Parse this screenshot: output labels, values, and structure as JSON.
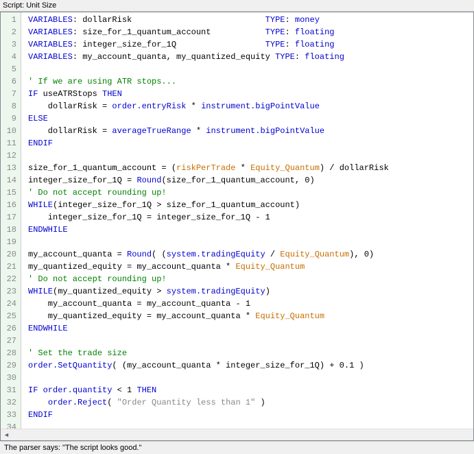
{
  "window": {
    "title": "Script: Unit Size"
  },
  "status": {
    "text": "The parser says: \"The script looks good.\""
  },
  "code": {
    "lines": [
      [
        {
          "t": "VARIABLES",
          "c": "kw"
        },
        {
          "t": ": dollarRisk                           ",
          "c": ""
        },
        {
          "t": "TYPE",
          "c": "kw"
        },
        {
          "t": ": ",
          "c": ""
        },
        {
          "t": "money",
          "c": "kw"
        }
      ],
      [
        {
          "t": "VARIABLES",
          "c": "kw"
        },
        {
          "t": ": size_for_1_quantum_account           ",
          "c": ""
        },
        {
          "t": "TYPE",
          "c": "kw"
        },
        {
          "t": ": ",
          "c": ""
        },
        {
          "t": "floating",
          "c": "kw"
        }
      ],
      [
        {
          "t": "VARIABLES",
          "c": "kw"
        },
        {
          "t": ": integer_size_for_1Q                  ",
          "c": ""
        },
        {
          "t": "TYPE",
          "c": "kw"
        },
        {
          "t": ": ",
          "c": ""
        },
        {
          "t": "floating",
          "c": "kw"
        }
      ],
      [
        {
          "t": "VARIABLES",
          "c": "kw"
        },
        {
          "t": ": my_account_quanta, my_quantized_equity ",
          "c": ""
        },
        {
          "t": "TYPE",
          "c": "kw"
        },
        {
          "t": ": ",
          "c": ""
        },
        {
          "t": "floating",
          "c": "kw"
        }
      ],
      [],
      [
        {
          "t": "' If we are using ATR stops...",
          "c": "com"
        }
      ],
      [
        {
          "t": "IF",
          "c": "kw"
        },
        {
          "t": " useATRStops ",
          "c": ""
        },
        {
          "t": "THEN",
          "c": "kw"
        }
      ],
      [
        {
          "t": "    dollarRisk = ",
          "c": ""
        },
        {
          "t": "order.entryRisk",
          "c": "kw"
        },
        {
          "t": " * ",
          "c": ""
        },
        {
          "t": "instrument.bigPointValue",
          "c": "kw"
        }
      ],
      [
        {
          "t": "ELSE",
          "c": "kw"
        }
      ],
      [
        {
          "t": "    dollarRisk = ",
          "c": ""
        },
        {
          "t": "averageTrueRange",
          "c": "kw"
        },
        {
          "t": " * ",
          "c": ""
        },
        {
          "t": "instrument.bigPointValue",
          "c": "kw"
        }
      ],
      [
        {
          "t": "ENDIF",
          "c": "kw"
        }
      ],
      [],
      [
        {
          "t": "size_for_1_quantum_account = (",
          "c": ""
        },
        {
          "t": "riskPerTrade",
          "c": "sys"
        },
        {
          "t": " * ",
          "c": ""
        },
        {
          "t": "Equity_Quantum",
          "c": "sys"
        },
        {
          "t": ") / dollarRisk",
          "c": ""
        }
      ],
      [
        {
          "t": "integer_size_for_1Q = ",
          "c": ""
        },
        {
          "t": "Round",
          "c": "kw"
        },
        {
          "t": "(size_for_1_quantum_account, 0)",
          "c": ""
        }
      ],
      [
        {
          "t": "' Do not accept rounding up!",
          "c": "com"
        }
      ],
      [
        {
          "t": "WHILE",
          "c": "kw"
        },
        {
          "t": "(integer_size_for_1Q > size_for_1_quantum_account)",
          "c": ""
        }
      ],
      [
        {
          "t": "    integer_size_for_1Q = integer_size_for_1Q - 1",
          "c": ""
        }
      ],
      [
        {
          "t": "ENDWHILE",
          "c": "kw"
        }
      ],
      [],
      [
        {
          "t": "my_account_quanta = ",
          "c": ""
        },
        {
          "t": "Round",
          "c": "kw"
        },
        {
          "t": "( (",
          "c": ""
        },
        {
          "t": "system.tradingEquity",
          "c": "kw"
        },
        {
          "t": " / ",
          "c": ""
        },
        {
          "t": "Equity_Quantum",
          "c": "sys"
        },
        {
          "t": "), 0)",
          "c": ""
        }
      ],
      [
        {
          "t": "my_quantized_equity = my_account_quanta * ",
          "c": ""
        },
        {
          "t": "Equity_Quantum",
          "c": "sys"
        }
      ],
      [
        {
          "t": "' Do not accept rounding up!",
          "c": "com"
        }
      ],
      [
        {
          "t": "WHILE",
          "c": "kw"
        },
        {
          "t": "(my_quantized_equity > ",
          "c": ""
        },
        {
          "t": "system.tradingEquity",
          "c": "kw"
        },
        {
          "t": ")",
          "c": ""
        }
      ],
      [
        {
          "t": "    my_account_quanta = my_account_quanta - 1",
          "c": ""
        }
      ],
      [
        {
          "t": "    my_quantized_equity = my_account_quanta * ",
          "c": ""
        },
        {
          "t": "Equity_Quantum",
          "c": "sys"
        }
      ],
      [
        {
          "t": "ENDWHILE",
          "c": "kw"
        }
      ],
      [],
      [
        {
          "t": "' Set the trade size",
          "c": "com"
        }
      ],
      [
        {
          "t": "order.SetQuantity",
          "c": "kw"
        },
        {
          "t": "( (my_account_quanta * integer_size_for_1Q) + 0.1 )",
          "c": ""
        }
      ],
      [],
      [
        {
          "t": "IF",
          "c": "kw"
        },
        {
          "t": " ",
          "c": ""
        },
        {
          "t": "order.quantity",
          "c": "kw"
        },
        {
          "t": " < 1 ",
          "c": ""
        },
        {
          "t": "THEN",
          "c": "kw"
        }
      ],
      [
        {
          "t": "    ",
          "c": ""
        },
        {
          "t": "order.Reject",
          "c": "kw"
        },
        {
          "t": "( ",
          "c": ""
        },
        {
          "t": "\"Order Quantity less than 1\"",
          "c": "str"
        },
        {
          "t": " )",
          "c": ""
        }
      ],
      [
        {
          "t": "ENDIF",
          "c": "kw"
        }
      ],
      []
    ]
  }
}
